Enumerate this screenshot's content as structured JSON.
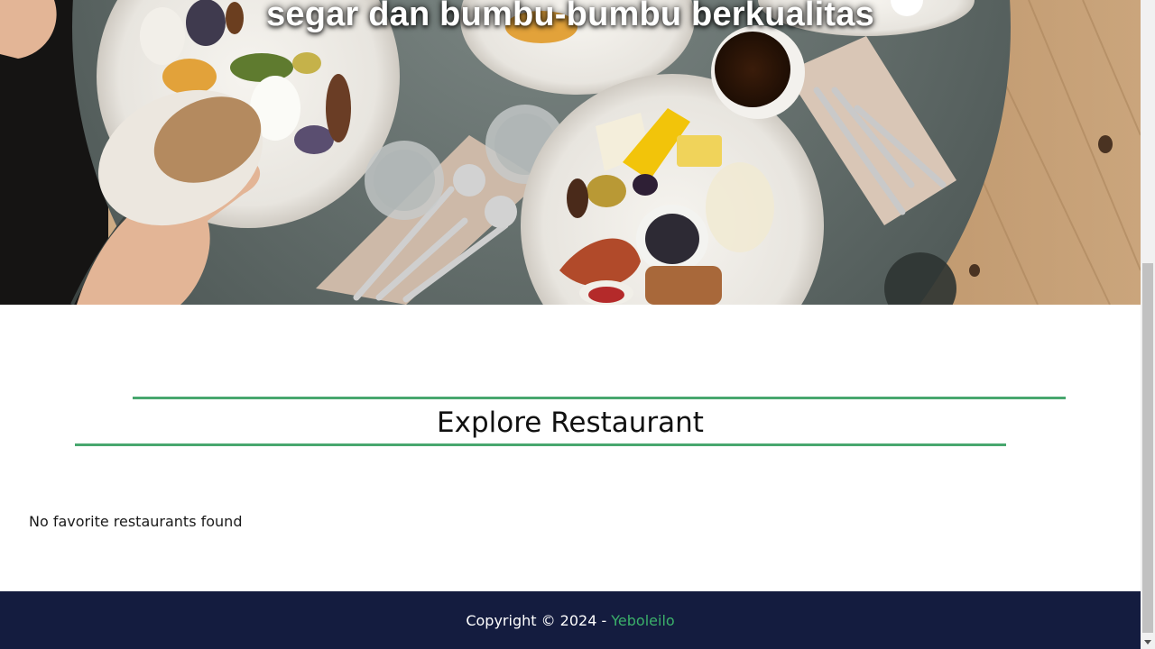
{
  "hero": {
    "tagline": "segar dan bumbu-bumbu berkualitas",
    "image": "food-table-photo"
  },
  "main": {
    "section_title": "Explore Restaurant",
    "empty_message": "No favorite restaurants found"
  },
  "footer": {
    "copyright": "Copyright © 2024 -",
    "brand": "Yeboleilo"
  },
  "colors": {
    "accent": "#48a76e",
    "footer_bg": "#141c3f",
    "brand_link": "#3bb06a"
  }
}
